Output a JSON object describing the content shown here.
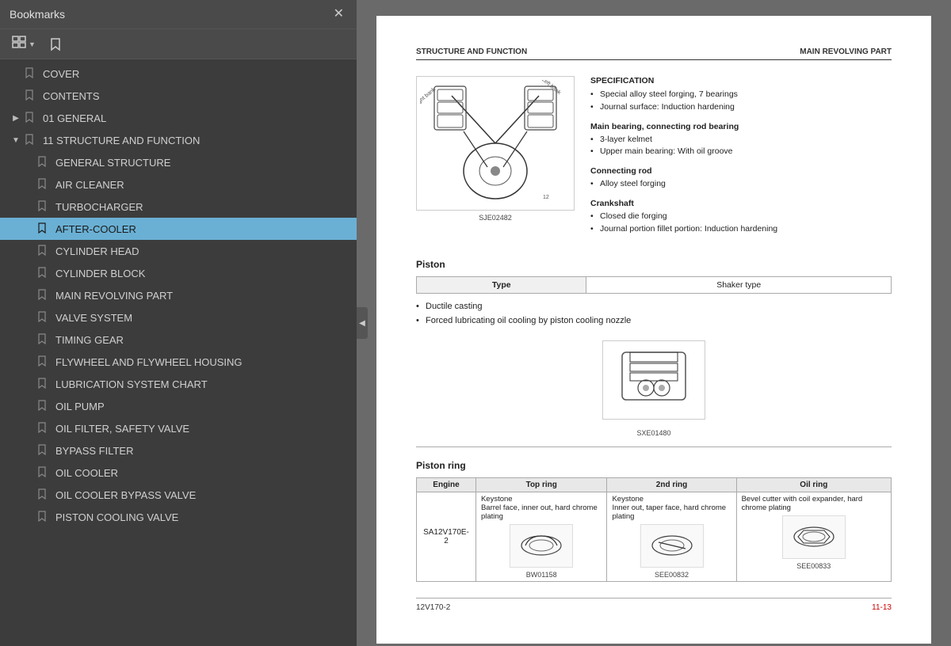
{
  "bookmarks": {
    "title": "Bookmarks",
    "close_label": "✕",
    "toolbar": {
      "view_btn": "☰",
      "bookmark_btn": "🔖"
    },
    "items": [
      {
        "id": "cover",
        "label": "COVER",
        "level": 0,
        "expandable": false,
        "expanded": false,
        "active": false
      },
      {
        "id": "contents",
        "label": "CONTENTS",
        "level": 0,
        "expandable": false,
        "expanded": false,
        "active": false
      },
      {
        "id": "01-general",
        "label": "01 GENERAL",
        "level": 0,
        "expandable": true,
        "expanded": false,
        "active": false
      },
      {
        "id": "11-structure",
        "label": "11 STRUCTURE AND FUNCTION",
        "level": 0,
        "expandable": true,
        "expanded": true,
        "active": false
      },
      {
        "id": "general-structure",
        "label": "GENERAL STRUCTURE",
        "level": 1,
        "expandable": false,
        "expanded": false,
        "active": false
      },
      {
        "id": "air-cleaner",
        "label": "AIR CLEANER",
        "level": 1,
        "expandable": false,
        "expanded": false,
        "active": false
      },
      {
        "id": "turbocharger",
        "label": "TURBOCHARGER",
        "level": 1,
        "expandable": false,
        "expanded": false,
        "active": false
      },
      {
        "id": "after-cooler",
        "label": "AFTER-COOLER",
        "level": 1,
        "expandable": false,
        "expanded": false,
        "active": true
      },
      {
        "id": "cylinder-head",
        "label": "CYLINDER HEAD",
        "level": 1,
        "expandable": false,
        "expanded": false,
        "active": false
      },
      {
        "id": "cylinder-block",
        "label": "CYLINDER BLOCK",
        "level": 1,
        "expandable": false,
        "expanded": false,
        "active": false
      },
      {
        "id": "main-revolving",
        "label": "MAIN REVOLVING PART",
        "level": 1,
        "expandable": false,
        "expanded": false,
        "active": false
      },
      {
        "id": "valve-system",
        "label": "VALVE SYSTEM",
        "level": 1,
        "expandable": false,
        "expanded": false,
        "active": false
      },
      {
        "id": "timing-gear",
        "label": "TIMING GEAR",
        "level": 1,
        "expandable": false,
        "expanded": false,
        "active": false
      },
      {
        "id": "flywheel",
        "label": "FLYWHEEL AND FLYWHEEL HOUSING",
        "level": 1,
        "expandable": false,
        "expanded": false,
        "active": false
      },
      {
        "id": "lub-chart",
        "label": "LUBRICATION SYSTEM CHART",
        "level": 1,
        "expandable": false,
        "expanded": false,
        "active": false
      },
      {
        "id": "oil-pump",
        "label": "OIL PUMP",
        "level": 1,
        "expandable": false,
        "expanded": false,
        "active": false
      },
      {
        "id": "oil-filter",
        "label": "OIL FILTER, SAFETY VALVE",
        "level": 1,
        "expandable": false,
        "expanded": false,
        "active": false
      },
      {
        "id": "bypass-filter",
        "label": "BYPASS FILTER",
        "level": 1,
        "expandable": false,
        "expanded": false,
        "active": false
      },
      {
        "id": "oil-cooler",
        "label": "OIL COOLER",
        "level": 1,
        "expandable": false,
        "expanded": false,
        "active": false
      },
      {
        "id": "oil-cooler-bypass",
        "label": "OIL COOLER BYPASS VALVE",
        "level": 1,
        "expandable": false,
        "expanded": false,
        "active": false
      },
      {
        "id": "piston-cooling",
        "label": "PISTON COOLING VALVE",
        "level": 1,
        "expandable": false,
        "expanded": false,
        "active": false
      }
    ]
  },
  "document": {
    "header_left": "STRUCTURE AND FUNCTION",
    "header_right": "MAIN REVOLVING PART",
    "spec_title": "SPECIFICATION",
    "spec_items": [
      "Special alloy steel forging, 7 bearings",
      "Journal surface: Induction hardening"
    ],
    "main_bearing_title": "Main bearing, connecting rod bearing",
    "main_bearing_items": [
      "3-layer kelmet",
      "Upper main bearing: With oil groove"
    ],
    "connecting_rod_title": "Connecting rod",
    "connecting_rod_items": [
      "Alloy steel forging"
    ],
    "crankshaft_title": "Crankshaft",
    "crankshaft_items": [
      "Closed die forging",
      "Journal portion fillet portion: Induction hardening"
    ],
    "diagram_caption": "SJE02482",
    "piston_heading": "Piston",
    "piston_table": {
      "col1": "Type",
      "col2": "Shaker type"
    },
    "piston_features": [
      "Ductile casting",
      "Forced lubricating oil cooling by piston cooling nozzle"
    ],
    "piston_diagram_caption": "SXE01480",
    "piston_ring_heading": "Piston ring",
    "ring_table": {
      "headers": [
        "Engine",
        "Top ring",
        "2nd ring",
        "Oil ring"
      ],
      "rows": [
        {
          "engine": "SA12V170E-2",
          "top_ring_text": "Keystone\nBarrel face, inner out, hard chrome plating",
          "top_ring_caption": "BW01158",
          "second_ring_text": "Keystone\nInner out, taper face, hard chrome plating",
          "second_ring_caption": "SEE00832",
          "oil_ring_text": "Bevel cutter with coil expander, hard chrome plating",
          "oil_ring_caption": "SEE00833"
        }
      ]
    },
    "footer_left": "12V170-2",
    "footer_right": "11-13"
  }
}
